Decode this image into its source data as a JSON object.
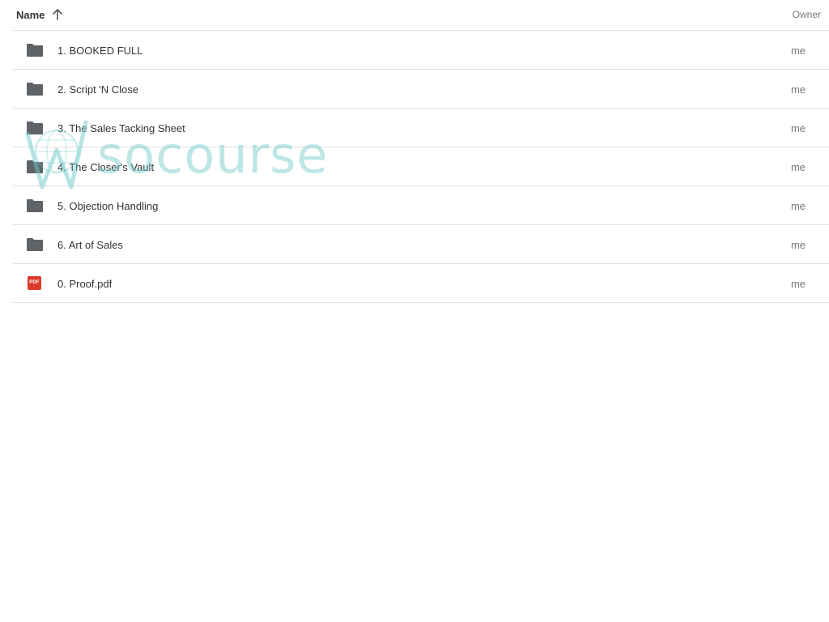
{
  "header": {
    "name_label": "Name",
    "owner_label": "Owner",
    "sort_icon": "arrow-up-icon"
  },
  "rows": [
    {
      "name": "1. BOOKED FULL",
      "owner": "me",
      "type": "folder"
    },
    {
      "name": "2. Script 'N Close",
      "owner": "me",
      "type": "folder"
    },
    {
      "name": "3. The Sales Tacking Sheet",
      "owner": "me",
      "type": "folder"
    },
    {
      "name": "4. The Closer's Vault",
      "owner": "me",
      "type": "folder"
    },
    {
      "name": "5. Objection Handling",
      "owner": "me",
      "type": "folder"
    },
    {
      "name": "6. Art of Sales",
      "owner": "me",
      "type": "folder"
    },
    {
      "name": "0. Proof.pdf",
      "owner": "me",
      "type": "pdf"
    }
  ],
  "pdf_badge": "PDF",
  "watermark": {
    "text": "socourse",
    "color": "#6ec8c8"
  },
  "colors": {
    "folder": "#5f6368",
    "pdf": "#db3b2b",
    "divider": "#e0e0e0"
  }
}
